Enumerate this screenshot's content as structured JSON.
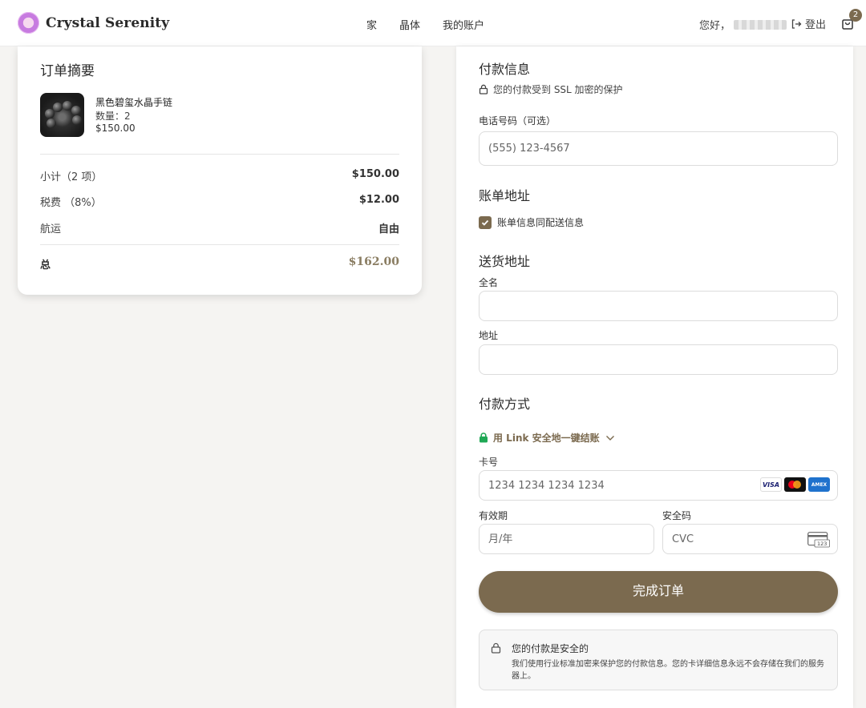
{
  "header": {
    "brand": "Crystal Serenity",
    "nav": [
      "家",
      "晶体",
      "我的账户"
    ],
    "greeting": "您好，",
    "logout_label": "登出",
    "cart_count": "2"
  },
  "summary": {
    "title": "订单摘要",
    "product": {
      "name": "黑色碧玺水晶手链",
      "qty_label": "数量：",
      "qty": "2",
      "price": "$150.00"
    },
    "rows": [
      {
        "label": "小计（2 项）",
        "value": "$150.00"
      },
      {
        "label": "税费 （8%）",
        "value": "$12.00"
      },
      {
        "label": "航运",
        "value": "自由"
      }
    ],
    "total_label": "总",
    "total_value": "$162.00"
  },
  "payment": {
    "title": "付款信息",
    "ssl_note": "您的付款受到 SSL 加密的保护",
    "phone_label": "电话号码（可选）",
    "phone_placeholder": "(555) 123-4567",
    "billing_title": "账单地址",
    "billing_same_label": "账单信息同配送信息",
    "billing_same_checked": true,
    "shipping_title": "送货地址",
    "fullname_label": "全名",
    "address_label": "地址",
    "method_title": "付款方式",
    "link_label": "用 Link 安全地一键结账",
    "card_number_label": "卡号",
    "card_number_placeholder": "1234 1234 1234 1234",
    "expiry_label": "有效期",
    "expiry_placeholder": "月/年",
    "cvc_label": "安全码",
    "cvc_placeholder": "CVC",
    "card_brands": [
      "VISA",
      "mastercard",
      "AMEX"
    ],
    "submit_label": "完成订单",
    "secure_title": "您的付款是安全的",
    "secure_text": "我们使用行业标准加密来保护您的付款信息。您的卡详细信息永远不会存储在我们的服务器上。",
    "cvc_icon_text": "123"
  },
  "colors": {
    "accent": "#7b6a4f",
    "total": "#8a7d62",
    "lock_green": "#1fa855"
  }
}
